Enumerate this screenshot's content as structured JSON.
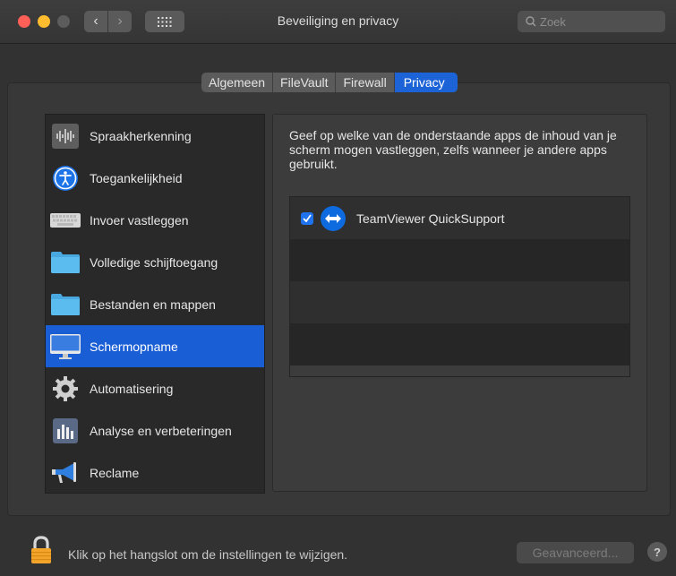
{
  "window": {
    "title": "Beveiliging en privacy"
  },
  "search": {
    "placeholder": "Zoek"
  },
  "tabs": [
    {
      "label": "Algemeen",
      "active": false
    },
    {
      "label": "FileVault",
      "active": false
    },
    {
      "label": "Firewall",
      "active": false
    },
    {
      "label": "Privacy",
      "active": true
    }
  ],
  "sidebar": {
    "items": [
      {
        "label": "Spraakherkenning",
        "icon": "waveform-icon"
      },
      {
        "label": "Toegankelijkheid",
        "icon": "accessibility-icon"
      },
      {
        "label": "Invoer vastleggen",
        "icon": "keyboard-icon"
      },
      {
        "label": "Volledige schijftoegang",
        "icon": "folder-icon"
      },
      {
        "label": "Bestanden en mappen",
        "icon": "folder-icon"
      },
      {
        "label": "Schermopname",
        "icon": "display-icon",
        "selected": true
      },
      {
        "label": "Automatisering",
        "icon": "gear-icon"
      },
      {
        "label": "Analyse en verbeteringen",
        "icon": "bar-chart-icon"
      },
      {
        "label": "Reclame",
        "icon": "megaphone-icon"
      }
    ]
  },
  "detail": {
    "description": "Geef op welke van de onderstaande apps de inhoud van je scherm mogen vastleggen, zelfs wanneer je andere apps gebruikt.",
    "apps": [
      {
        "name": "TeamViewer QuickSupport",
        "checked": true,
        "icon": "teamviewer-icon"
      }
    ]
  },
  "footer": {
    "lock_text": "Klik op het hangslot om de instellingen te wijzigen.",
    "advanced_label": "Geavanceerd...",
    "help_label": "?"
  },
  "colors": {
    "accent": "#1a5ed6",
    "close": "#fe5f57",
    "minimize": "#febc2e"
  }
}
